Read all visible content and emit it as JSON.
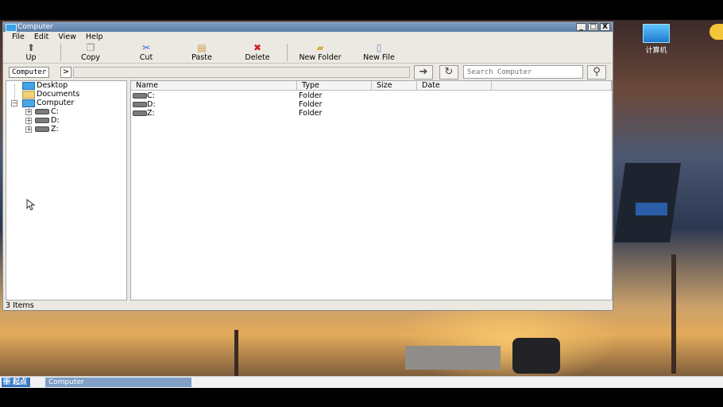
{
  "window": {
    "title": "Computer",
    "controls": {
      "minimize": "_",
      "maximize": "□",
      "close": "X"
    }
  },
  "menu": [
    "File",
    "Edit",
    "View",
    "Help"
  ],
  "toolbar": {
    "up": "Up",
    "copy": "Copy",
    "cut": "Cut",
    "paste": "Paste",
    "delete": "Delete",
    "new_folder": "New Folder",
    "new_file": "New File"
  },
  "address": {
    "crumb": "Computer",
    "crumb_arrow": ">",
    "search_placeholder": "Search Computer"
  },
  "tree": {
    "desktop": "Desktop",
    "documents": "Documents",
    "computer": "Computer",
    "drives": [
      "C:",
      "D:",
      "Z:"
    ]
  },
  "files": {
    "columns": [
      "Name",
      "Type",
      "Size",
      "Date"
    ],
    "rows": [
      {
        "name": "C:",
        "type": "Folder"
      },
      {
        "name": "D:",
        "type": "Folder"
      },
      {
        "name": "Z:",
        "type": "Folder"
      }
    ]
  },
  "status": "3 Items",
  "desktop_icons": [
    {
      "label": "计算机",
      "icon": "computer-icon"
    }
  ],
  "taskbar": {
    "start": "起点",
    "task": "Computer"
  },
  "colors": {
    "titlebar": "#6b8db5",
    "taskbar_item": "#7f9fc5",
    "start_button": "#3b78c0"
  }
}
